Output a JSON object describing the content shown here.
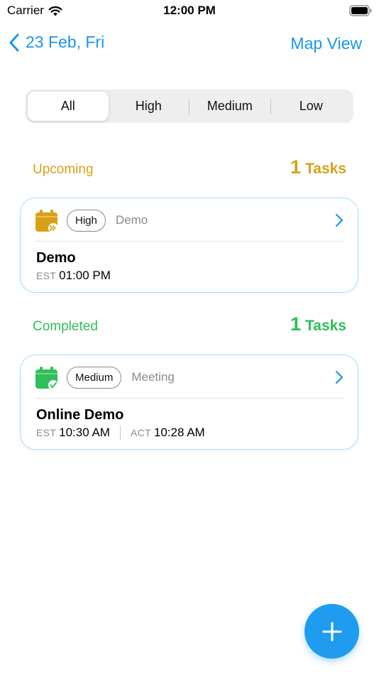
{
  "status_bar": {
    "carrier": "Carrier",
    "time": "12:00 PM"
  },
  "nav": {
    "back_label": "23 Feb, Fri",
    "right_label": "Map View"
  },
  "filters": {
    "options": [
      "All",
      "High",
      "Medium",
      "Low"
    ],
    "selected": "All"
  },
  "sections": [
    {
      "title": "Upcoming",
      "count": "1",
      "count_label": "Tasks",
      "color": "#d7a016",
      "tasks": [
        {
          "priority": "High",
          "category": "Demo",
          "title": "Demo",
          "est_label": "EST",
          "est_time": "01:00 PM",
          "icon": "calendar-forward-icon",
          "icon_color": "#d7a016"
        }
      ]
    },
    {
      "title": "Completed",
      "count": "1",
      "count_label": "Tasks",
      "color": "#2fbf58",
      "tasks": [
        {
          "priority": "Medium",
          "category": "Meeting",
          "title": "Online Demo",
          "est_label": "EST",
          "est_time": "10:30 AM",
          "act_label": "ACT",
          "act_time": "10:28 AM",
          "icon": "calendar-check-icon",
          "icon_color": "#2fbf58"
        }
      ]
    }
  ],
  "colors": {
    "accent": "#1a96e8",
    "fab": "#1f9cf0",
    "card_border": "#a8dcf6"
  }
}
